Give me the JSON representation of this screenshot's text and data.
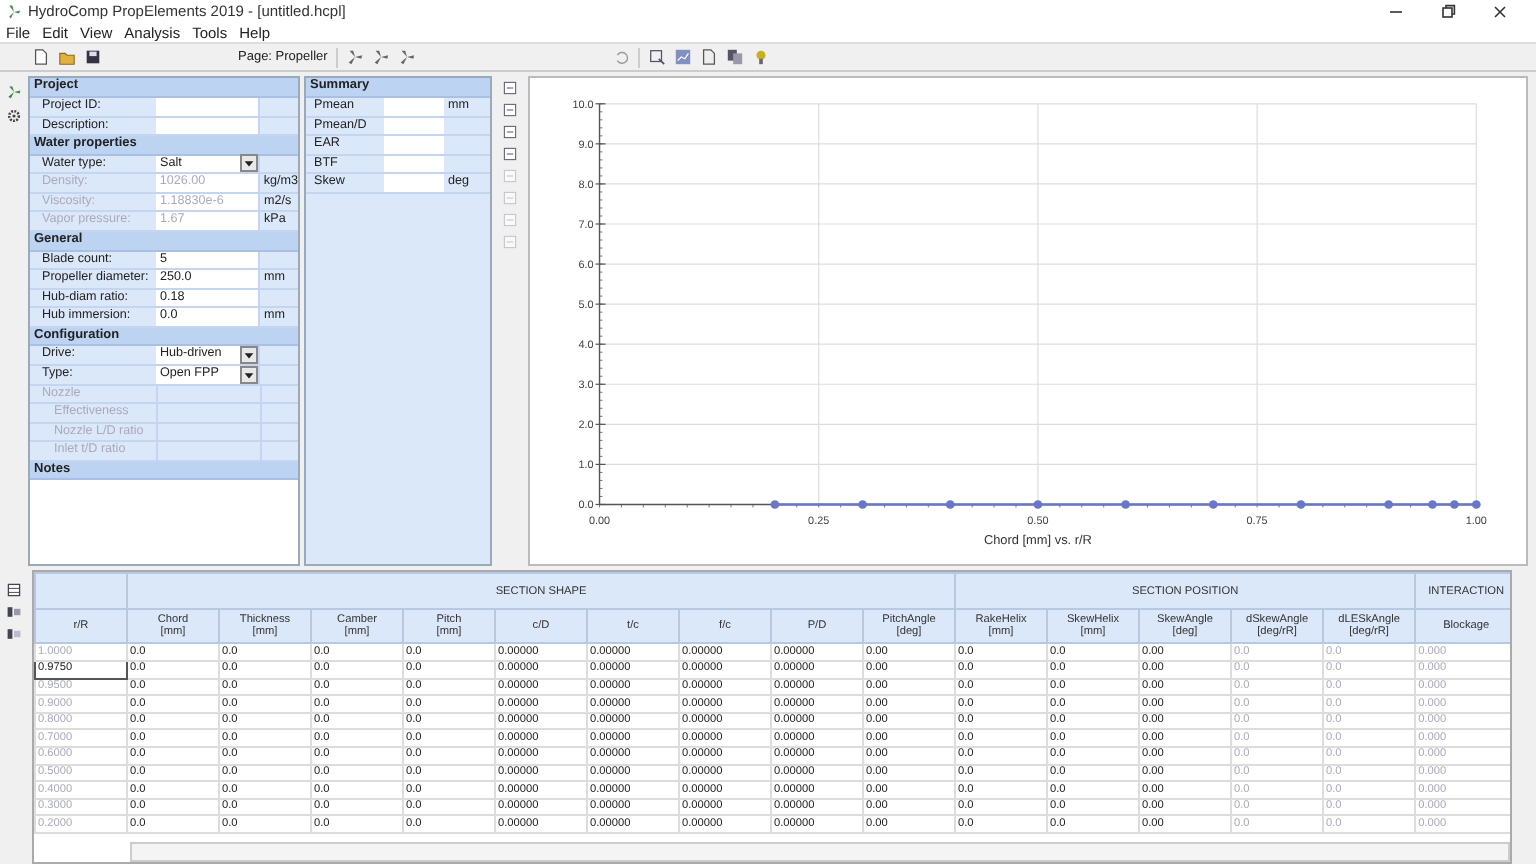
{
  "window": {
    "title": "HydroComp PropElements 2019 - [untitled.hcpl]"
  },
  "menu": [
    "File",
    "Edit",
    "View",
    "Analysis",
    "Tools",
    "Help"
  ],
  "toolbar": {
    "page_label": "Page: Propeller"
  },
  "properties": [
    {
      "title": "Project",
      "rows": [
        {
          "label": "Project ID:",
          "kind": "text",
          "disabled": false
        },
        {
          "label": "Description:",
          "kind": "text",
          "disabled": false
        }
      ]
    },
    {
      "title": "Water properties",
      "rows": [
        {
          "label": "Water type:",
          "value": "Salt",
          "kind": "select",
          "disabled": false
        },
        {
          "label": "Density:",
          "value": "1026.00",
          "unit": "kg/m3",
          "kind": "text",
          "disabled": true
        },
        {
          "label": "Viscosity:",
          "value": "1.18830e-6",
          "unit": "m2/s",
          "kind": "text",
          "disabled": true
        },
        {
          "label": "Vapor pressure:",
          "value": "1.67",
          "unit": "kPa",
          "kind": "text",
          "disabled": true
        }
      ]
    },
    {
      "title": "General",
      "rows": [
        {
          "label": "Blade count:",
          "value": "5",
          "kind": "text",
          "disabled": false
        },
        {
          "label": "Propeller diameter:",
          "value": "250.0",
          "unit": "mm",
          "kind": "text",
          "disabled": false
        },
        {
          "label": "Hub-diam ratio:",
          "value": "0.18",
          "kind": "text",
          "disabled": false
        },
        {
          "label": "Hub immersion:",
          "value": "0.0",
          "unit": "mm",
          "kind": "text",
          "disabled": false
        }
      ]
    },
    {
      "title": "Configuration",
      "rows": [
        {
          "label": "Drive:",
          "value": "Hub-driven",
          "kind": "select",
          "disabled": false
        },
        {
          "label": "Type:",
          "value": "Open FPP",
          "kind": "select",
          "disabled": false
        },
        {
          "label": "Nozzle",
          "kind": "text",
          "disabled": true,
          "children": [
            {
              "label": "Effectiveness",
              "kind": "text",
              "disabled": true
            },
            {
              "label": "Nozzle L/D ratio",
              "kind": "text",
              "disabled": true
            },
            {
              "label": "Inlet t/D ratio",
              "kind": "text",
              "disabled": true
            }
          ]
        }
      ]
    },
    {
      "title": "Notes"
    }
  ],
  "summary": {
    "title": "Summary",
    "rows": [
      {
        "label": "Pmean",
        "unit": "mm"
      },
      {
        "label": "Pmean/D"
      },
      {
        "label": "EAR"
      },
      {
        "label": "BTF"
      },
      {
        "label": "Skew",
        "unit": "deg"
      }
    ]
  },
  "chart": {
    "chart_data": {
      "type": "line",
      "grid": true,
      "xlabel": "Chord [mm] vs. r/R",
      "x": [
        0.2,
        0.3,
        0.4,
        0.5,
        0.6,
        0.7,
        0.8,
        0.9,
        0.95,
        0.975,
        1.0
      ],
      "series": [
        {
          "color": "#6a76c8",
          "marker": "circle",
          "values": [
            0,
            0,
            0,
            0,
            0,
            0,
            0,
            0,
            0,
            0,
            0
          ]
        }
      ],
      "xlim": [
        0,
        1
      ],
      "ylim": [
        0,
        10
      ],
      "xticks": [
        {
          "value": 0,
          "label": "0.00"
        },
        {
          "value": 0.25,
          "label": "0.25"
        },
        {
          "value": 0.5,
          "label": "0.50"
        },
        {
          "value": 0.75,
          "label": "0.75"
        },
        {
          "value": 1,
          "label": "1.00"
        }
      ],
      "yticks": [
        {
          "value": 0,
          "label": "0.0"
        },
        {
          "value": 1,
          "label": "1.0"
        },
        {
          "value": 2,
          "label": "2.0"
        },
        {
          "value": 3,
          "label": "3.0"
        },
        {
          "value": 4,
          "label": "4.0"
        },
        {
          "value": 5,
          "label": "5.0"
        },
        {
          "value": 6,
          "label": "6.0"
        },
        {
          "value": 7,
          "label": "7.0"
        },
        {
          "value": 8,
          "label": "8.0"
        },
        {
          "value": 9,
          "label": "9.0"
        },
        {
          "value": 10,
          "label": "10.0"
        }
      ]
    }
  },
  "table": {
    "groups": [
      {
        "columns": [
          {
            "label": "r/R",
            "disabled": true
          }
        ]
      },
      {
        "label": "SECTION SHAPE",
        "columns": [
          {
            "label": "Chord",
            "unit": "[mm]",
            "disabled": false
          },
          {
            "label": "Thickness",
            "unit": "[mm]",
            "disabled": false
          },
          {
            "label": "Camber",
            "unit": "[mm]",
            "disabled": false
          },
          {
            "label": "Pitch",
            "unit": "[mm]",
            "disabled": false
          },
          {
            "label": "c/D",
            "disabled": false
          },
          {
            "label": "t/c",
            "disabled": false
          },
          {
            "label": "f/c",
            "disabled": false
          },
          {
            "label": "P/D",
            "disabled": false
          },
          {
            "label": "PitchAngle",
            "unit": "[deg]",
            "disabled": false
          }
        ]
      },
      {
        "label": "SECTION POSITION",
        "columns": [
          {
            "label": "RakeHelix",
            "unit": "[mm]",
            "disabled": false
          },
          {
            "label": "SkewHelix",
            "unit": "[mm]",
            "disabled": false
          },
          {
            "label": "SkewAngle",
            "unit": "[deg]",
            "disabled": false
          },
          {
            "label": "dSkewAngle",
            "unit": "[deg/rR]",
            "disabled": true
          },
          {
            "label": "dLESkAngle",
            "unit": "[deg/rR]",
            "disabled": true
          }
        ]
      },
      {
        "label": "INTERACTION",
        "columns": [
          {
            "label": "Blockage",
            "disabled": true
          }
        ]
      }
    ],
    "rows": [
      {
        "selected": false,
        "cells": [
          "1.0000",
          "0.0",
          "0.0",
          "0.0",
          "0.0",
          "0.00000",
          "0.00000",
          "0.00000",
          "0.00000",
          "0.00",
          "0.0",
          "0.0",
          "0.00",
          "0.0",
          "0.0",
          "0.000"
        ]
      },
      {
        "selected": true,
        "cells": [
          "0.9750",
          "0.0",
          "0.0",
          "0.0",
          "0.0",
          "0.00000",
          "0.00000",
          "0.00000",
          "0.00000",
          "0.00",
          "0.0",
          "0.0",
          "0.00",
          "0.0",
          "0.0",
          "0.000"
        ]
      },
      {
        "selected": false,
        "cells": [
          "0.9500",
          "0.0",
          "0.0",
          "0.0",
          "0.0",
          "0.00000",
          "0.00000",
          "0.00000",
          "0.00000",
          "0.00",
          "0.0",
          "0.0",
          "0.00",
          "0.0",
          "0.0",
          "0.000"
        ]
      },
      {
        "selected": false,
        "cells": [
          "0.9000",
          "0.0",
          "0.0",
          "0.0",
          "0.0",
          "0.00000",
          "0.00000",
          "0.00000",
          "0.00000",
          "0.00",
          "0.0",
          "0.0",
          "0.00",
          "0.0",
          "0.0",
          "0.000"
        ]
      },
      {
        "selected": false,
        "cells": [
          "0.8000",
          "0.0",
          "0.0",
          "0.0",
          "0.0",
          "0.00000",
          "0.00000",
          "0.00000",
          "0.00000",
          "0.00",
          "0.0",
          "0.0",
          "0.00",
          "0.0",
          "0.0",
          "0.000"
        ]
      },
      {
        "selected": false,
        "cells": [
          "0.7000",
          "0.0",
          "0.0",
          "0.0",
          "0.0",
          "0.00000",
          "0.00000",
          "0.00000",
          "0.00000",
          "0.00",
          "0.0",
          "0.0",
          "0.00",
          "0.0",
          "0.0",
          "0.000"
        ]
      },
      {
        "selected": false,
        "cells": [
          "0.6000",
          "0.0",
          "0.0",
          "0.0",
          "0.0",
          "0.00000",
          "0.00000",
          "0.00000",
          "0.00000",
          "0.00",
          "0.0",
          "0.0",
          "0.00",
          "0.0",
          "0.0",
          "0.000"
        ]
      },
      {
        "selected": false,
        "cells": [
          "0.5000",
          "0.0",
          "0.0",
          "0.0",
          "0.0",
          "0.00000",
          "0.00000",
          "0.00000",
          "0.00000",
          "0.00",
          "0.0",
          "0.0",
          "0.00",
          "0.0",
          "0.0",
          "0.000"
        ]
      },
      {
        "selected": false,
        "cells": [
          "0.4000",
          "0.0",
          "0.0",
          "0.0",
          "0.0",
          "0.00000",
          "0.00000",
          "0.00000",
          "0.00000",
          "0.00",
          "0.0",
          "0.0",
          "0.00",
          "0.0",
          "0.0",
          "0.000"
        ]
      },
      {
        "selected": false,
        "cells": [
          "0.3000",
          "0.0",
          "0.0",
          "0.0",
          "0.0",
          "0.00000",
          "0.00000",
          "0.00000",
          "0.00000",
          "0.00",
          "0.0",
          "0.0",
          "0.00",
          "0.0",
          "0.0",
          "0.000"
        ]
      },
      {
        "selected": false,
        "cells": [
          "0.2000",
          "0.0",
          "0.0",
          "0.0",
          "0.0",
          "0.00000",
          "0.00000",
          "0.00000",
          "0.00000",
          "0.00",
          "0.0",
          "0.0",
          "0.00",
          "0.0",
          "0.0",
          "0.000"
        ]
      }
    ]
  }
}
